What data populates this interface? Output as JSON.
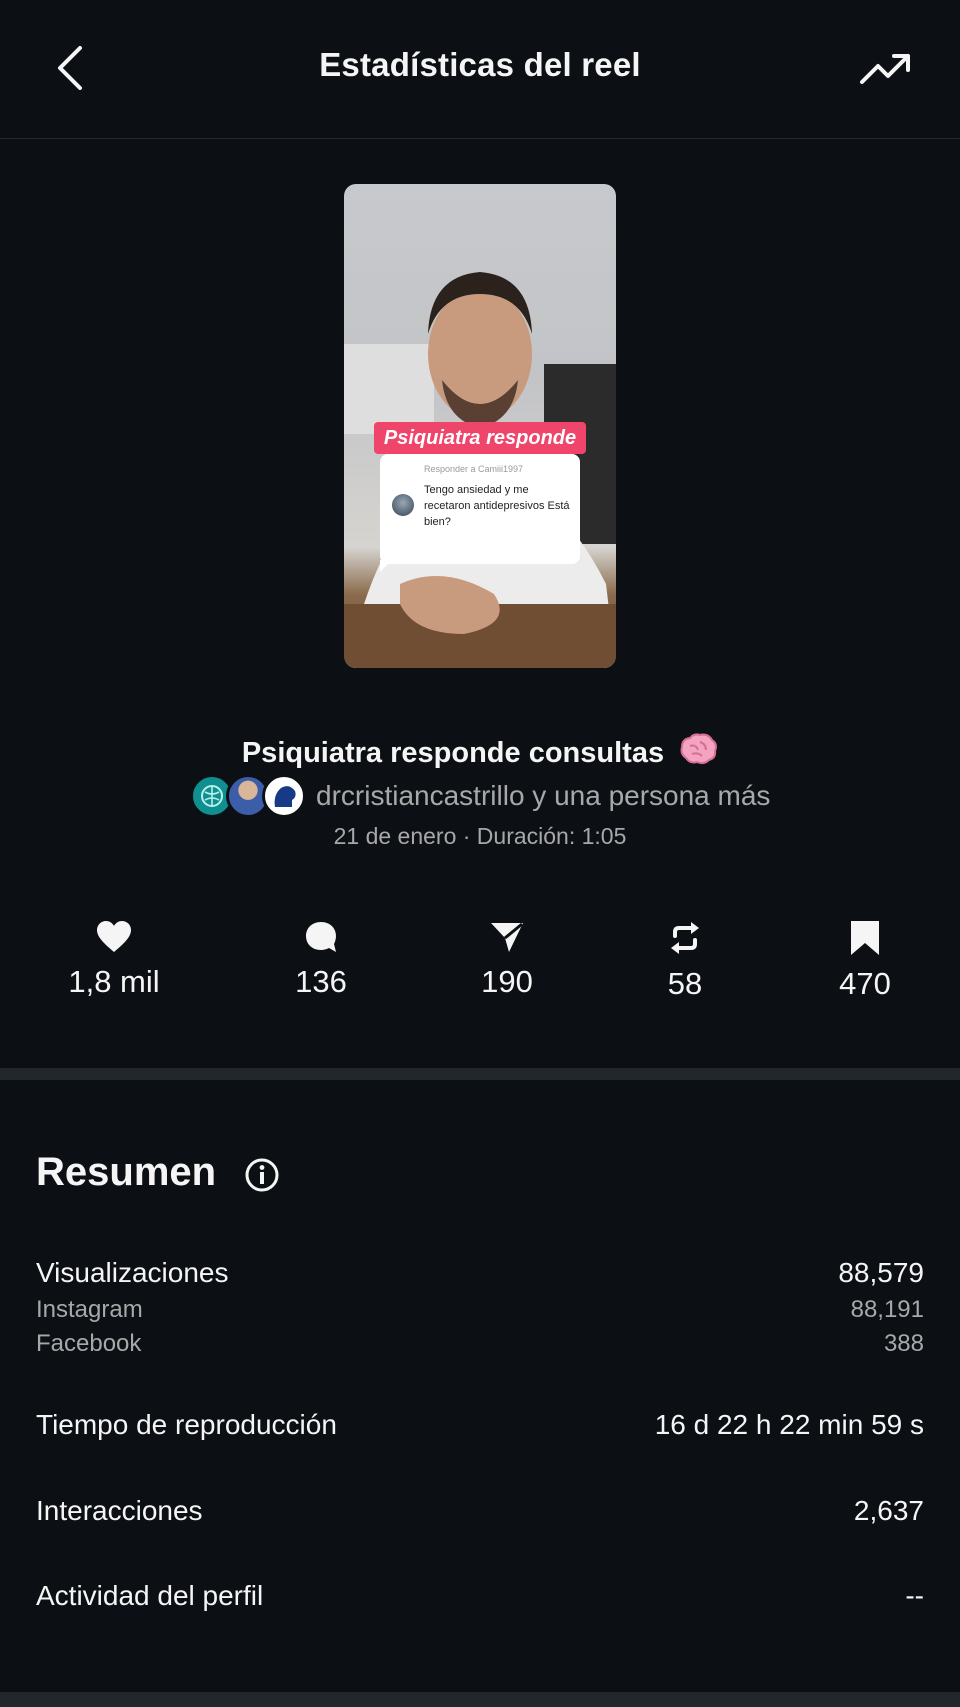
{
  "header": {
    "title": "Estadísticas del reel",
    "back_icon": "chevron-left-icon",
    "trend_icon": "trending-up-icon"
  },
  "thumbnail": {
    "sticker_tag": "Psiquiatra responde",
    "reply_label": "Responder a Camiii1997",
    "question": "Tengo ansiedad y me recetaron antidepresivos Está bien?"
  },
  "reel": {
    "title": "Psiquiatra responde consultas",
    "title_emoji_icon": "brain-icon",
    "collaborators": "drcristiancastrillo y una persona más",
    "meta": "21 de enero · Duración: 1:05"
  },
  "stats": [
    {
      "icon": "heart-icon",
      "value": "1,8 mil"
    },
    {
      "icon": "comment-icon",
      "value": "136"
    },
    {
      "icon": "send-icon",
      "value": "190"
    },
    {
      "icon": "repost-icon",
      "value": "58"
    },
    {
      "icon": "bookmark-icon",
      "value": "470"
    }
  ],
  "summary": {
    "title": "Resumen",
    "info_icon": "info-icon",
    "views_label": "Visualizaciones",
    "views_value": "88,579",
    "instagram_label": "Instagram",
    "instagram_value": "88,191",
    "facebook_label": "Facebook",
    "facebook_value": "388",
    "watch_time_label": "Tiempo de reproducción",
    "watch_time_value": "16 d 22 h 22 min 59 s",
    "interactions_label": "Interacciones",
    "interactions_value": "2,637",
    "profile_activity_label": "Actividad del perfil",
    "profile_activity_value": "--"
  },
  "colors": {
    "background": "#0c1014",
    "text": "#f5f5f5",
    "secondary_text": "#a8a8a8",
    "divider": "#22272c",
    "sticker_accent": "#f0456b"
  }
}
